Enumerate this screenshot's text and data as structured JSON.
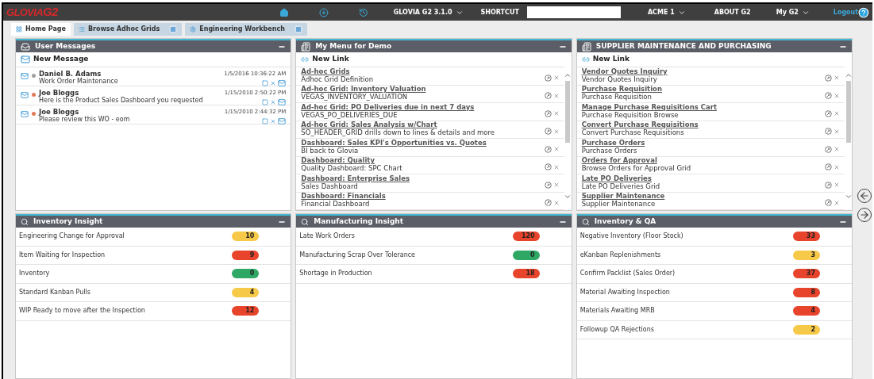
{
  "topbar": {
    "logo": "GLOVIA",
    "logo_mark": "G2",
    "version": "GLOVIA G2 3.1.0",
    "shortcut_label": "SHORTCUT",
    "company": "ACME 1",
    "about": "ABOUT G2",
    "my": "My G2",
    "logout": "Logout"
  },
  "tabs": [
    {
      "label": "Home Page",
      "selected": true,
      "closable": false
    },
    {
      "label": "Browse Adhoc Grids",
      "selected": false,
      "closable": true
    },
    {
      "label": "Engineering Workbench",
      "selected": false,
      "closable": true
    }
  ],
  "messages_panel": {
    "title": "User Messages",
    "new_label": "New Message",
    "messages": [
      {
        "sender": "Daniel B. Adams",
        "subject": "Work Order Maintenance",
        "time": "1/5/2016 10:36:22 AM",
        "color": "#a0a0a0"
      },
      {
        "sender": "Joe Bloggs",
        "subject": "Here is the Product Sales Dashboard you requested",
        "time": "1/15/2010 2:50:22 PM",
        "color": "#e07a5a"
      },
      {
        "sender": "Joe Bloggs",
        "subject": "Please review this WO - eom",
        "time": "1/15/2010 2:44:32 PM",
        "color": "#e07a5a"
      }
    ]
  },
  "link_panels": [
    {
      "title": "My Menu for Demo",
      "new_label": "New Link",
      "links": [
        {
          "title": "Ad-hoc Grids",
          "subtitle": "Adhoc Grid Definition"
        },
        {
          "title": "Ad-hoc Grid: Inventory Valuation",
          "subtitle": "VEGAS_INVENTORY_VALUATION"
        },
        {
          "title": "Ad-hoc Grid: PO Deliveries due in next 7 days",
          "subtitle": "VEGAS_PO_DELIVERIES_DUE"
        },
        {
          "title": "Ad-hoc Grid: Sales Analysis w/Chart",
          "subtitle": "SO_HEADER_GRID drills down to lines & details and more"
        },
        {
          "title": "Dashboard: Sales KPI's Opportunities vs. Quotes",
          "subtitle": "BI back to Glovia"
        },
        {
          "title": "Dashboard: Quality",
          "subtitle": "Quality Dashboard: SPC Chart"
        },
        {
          "title": "Dashboard: Enterprise Sales",
          "subtitle": "Sales Dashboard"
        },
        {
          "title": "Dashboard: Financials",
          "subtitle": "Financial Dashboard"
        }
      ]
    },
    {
      "title": "SUPPLIER MAINTENANCE AND PURCHASING",
      "new_label": "New Link",
      "links": [
        {
          "title": "Vendor Quotes Inquiry",
          "subtitle": "Vendor Quotes Inquiry"
        },
        {
          "title": "Purchase Requisition",
          "subtitle": "Purchase Requisition"
        },
        {
          "title": "Manage Purchase Requisitions Cart",
          "subtitle": "Purchase Requisition Browse"
        },
        {
          "title": "Convert Purchase Requisitions",
          "subtitle": "Convert Purchase Requisitions"
        },
        {
          "title": "Purchase Orders",
          "subtitle": "Purchase Orders"
        },
        {
          "title": "Orders for Approval",
          "subtitle": "Browse Orders for Approval Grid"
        },
        {
          "title": "Late PO Deliveries",
          "subtitle": "Late PO Deliveries Grid"
        },
        {
          "title": "Supplier Maintenance",
          "subtitle": "Supplier Maintenance"
        }
      ]
    }
  ],
  "insight_panels": [
    {
      "title": "Inventory Insight",
      "items": [
        {
          "label": "Engineering Change for Approval",
          "count": "10",
          "color": "#f7c948"
        },
        {
          "label": "Item Waiting for Inspection",
          "count": "9",
          "color": "#e8432b"
        },
        {
          "label": "Inventory",
          "count": "0",
          "color": "#2fa866"
        },
        {
          "label": "Standard Kanban Pulls",
          "count": "4",
          "color": "#f7c948"
        },
        {
          "label": "WIP Ready to move after the Inspection",
          "count": "12",
          "color": "#e8432b"
        }
      ]
    },
    {
      "title": "Manufacturing Insight",
      "items": [
        {
          "label": "Late Work Orders",
          "count": "120",
          "color": "#e8432b"
        },
        {
          "label": "Manufacturing Scrap Over Tolerance",
          "count": "0",
          "color": "#2fa866"
        },
        {
          "label": "Shortage in Production",
          "count": "18",
          "color": "#e8432b"
        }
      ]
    },
    {
      "title": "Inventory & QA",
      "items": [
        {
          "label": "Negative Inventory (Floor Stock)",
          "count": "33",
          "color": "#e8432b"
        },
        {
          "label": "eKanban Replenishments",
          "count": "3",
          "color": "#f7c948"
        },
        {
          "label": "Confirm Packlist (Sales Order)",
          "count": "37",
          "color": "#e8432b"
        },
        {
          "label": "Material Awaiting Inspection",
          "count": "8",
          "color": "#e8432b"
        },
        {
          "label": "Materials Awaiting MRB",
          "count": "4",
          "color": "#e8432b"
        },
        {
          "label": "Followup QA Rejections",
          "count": "2",
          "color": "#f7c948"
        }
      ]
    }
  ]
}
